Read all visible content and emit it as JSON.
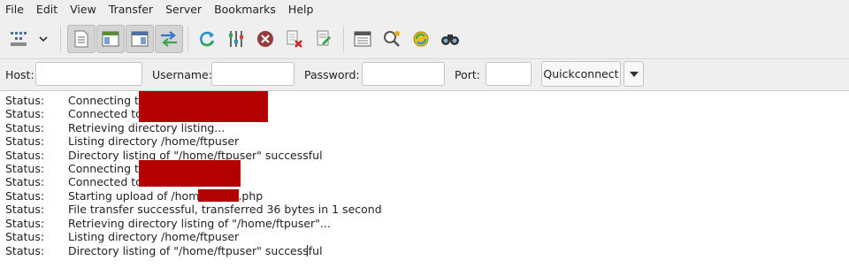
{
  "menu": [
    "File",
    "Edit",
    "View",
    "Transfer",
    "Server",
    "Bookmarks",
    "Help"
  ],
  "toolbar": {
    "buttons": [
      {
        "name": "site-manager-icon"
      },
      {
        "name": "chevron-down-icon"
      },
      {
        "name": "toggle-message-log-icon"
      },
      {
        "name": "toggle-local-tree-icon"
      },
      {
        "name": "toggle-remote-tree-icon"
      },
      {
        "name": "toggle-transfer-queue-icon"
      },
      {
        "name": "refresh-icon"
      },
      {
        "name": "process-queue-icon"
      },
      {
        "name": "cancel-operation-icon"
      },
      {
        "name": "disconnect-icon"
      },
      {
        "name": "reconnect-icon"
      },
      {
        "name": "directory-filters-icon"
      },
      {
        "name": "comparison-icon"
      },
      {
        "name": "sync-browsing-icon"
      },
      {
        "name": "search-icon"
      }
    ]
  },
  "quickconnect": {
    "host_label": "Host:",
    "username_label": "Username:",
    "password_label": "Password:",
    "port_label": "Port:",
    "host_value": "",
    "username_value": "",
    "password_value": "",
    "port_value": "",
    "button_label": "Quickconnect"
  },
  "log": [
    {
      "status": "Status:",
      "message": "Connecting to"
    },
    {
      "status": "Status:",
      "message": "Connected to"
    },
    {
      "status": "Status:",
      "message": "Retrieving directory listing..."
    },
    {
      "status": "Status:",
      "message": "Listing directory /home/ftpuser"
    },
    {
      "status": "Status:",
      "message": "Directory listing of \"/home/ftpuser\" successful"
    },
    {
      "status": "Status:",
      "message": "Connecting to"
    },
    {
      "status": "Status:",
      "message": "Connected to"
    },
    {
      "status": "Status:",
      "message": "Starting upload of /home/       /test.php"
    },
    {
      "status": "Status:",
      "message": "File transfer successful, transferred 36 bytes in 1 second"
    },
    {
      "status": "Status:",
      "message": "Retrieving directory listing of \"/home/ftpuser\"..."
    },
    {
      "status": "Status:",
      "message": "Listing directory /home/ftpuser"
    },
    {
      "status": "Status:",
      "message": "Directory listing of \"/home/ftpuser\" successful"
    }
  ],
  "colors": {
    "redaction": "#b30000",
    "accent_blue": "#3a78c9",
    "green": "#3aa64a"
  }
}
